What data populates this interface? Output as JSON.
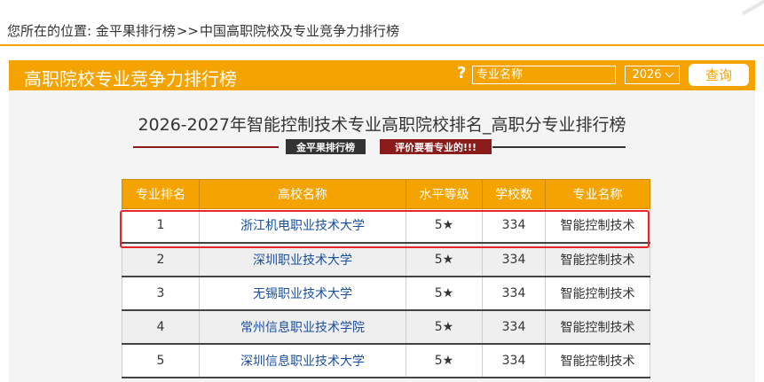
{
  "breadcrumb": {
    "prefix": "您所在的位置:",
    "items": [
      "金平果排行榜",
      "中国高职院校及专业竞争力排行榜"
    ],
    "separator": ">>"
  },
  "header": {
    "title": "高职院校专业竞争力排行榜",
    "help": "?",
    "search_placeholder": "专业名称",
    "year": "2026",
    "query_label": "查询"
  },
  "page": {
    "title": "2026-2027年智能控制技术专业高职院校排名_高职分专业排行榜",
    "badge_brand": "金平果排行榜",
    "badge_note": "评价要看专业的!!!"
  },
  "table": {
    "headers": [
      "专业排名",
      "高校名称",
      "水平等级",
      "学校数",
      "专业名称"
    ],
    "rows": [
      {
        "rank": "1",
        "school": "浙江机电职业技术大学",
        "level": "5★",
        "count": "334",
        "major": "智能控制技术"
      },
      {
        "rank": "2",
        "school": "深圳职业技术大学",
        "level": "5★",
        "count": "334",
        "major": "智能控制技术"
      },
      {
        "rank": "3",
        "school": "无锡职业技术大学",
        "level": "5★",
        "count": "334",
        "major": "智能控制技术"
      },
      {
        "rank": "4",
        "school": "常州信息职业技术学院",
        "level": "5★",
        "count": "334",
        "major": "智能控制技术"
      },
      {
        "rank": "5",
        "school": "深圳信息职业技术大学",
        "level": "5★",
        "count": "334",
        "major": "智能控制技术"
      }
    ]
  },
  "colors": {
    "accent": "#f5a300",
    "link": "#1a4fa0",
    "highlight": "#e8262a",
    "badge_dark": "#333333",
    "badge_red": "#8b1a1a"
  }
}
